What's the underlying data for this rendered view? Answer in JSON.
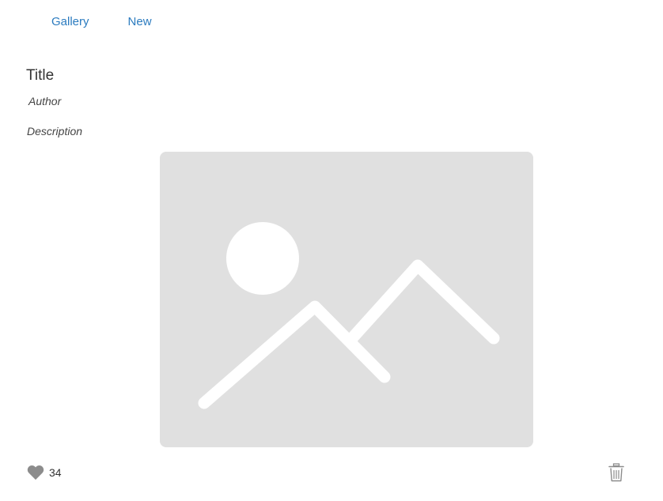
{
  "nav": {
    "items": [
      {
        "label": "Gallery"
      },
      {
        "label": "New"
      }
    ]
  },
  "post": {
    "title": "Title",
    "author": "Author",
    "description": "Description",
    "image_alt": "image-placeholder-icon",
    "likes": "34"
  },
  "icons": {
    "like": "heart-icon",
    "delete": "trash-icon"
  },
  "colors": {
    "link": "#2b7bbf",
    "placeholder_bg": "#e0e0e0",
    "icon": "#8c8c8c"
  }
}
